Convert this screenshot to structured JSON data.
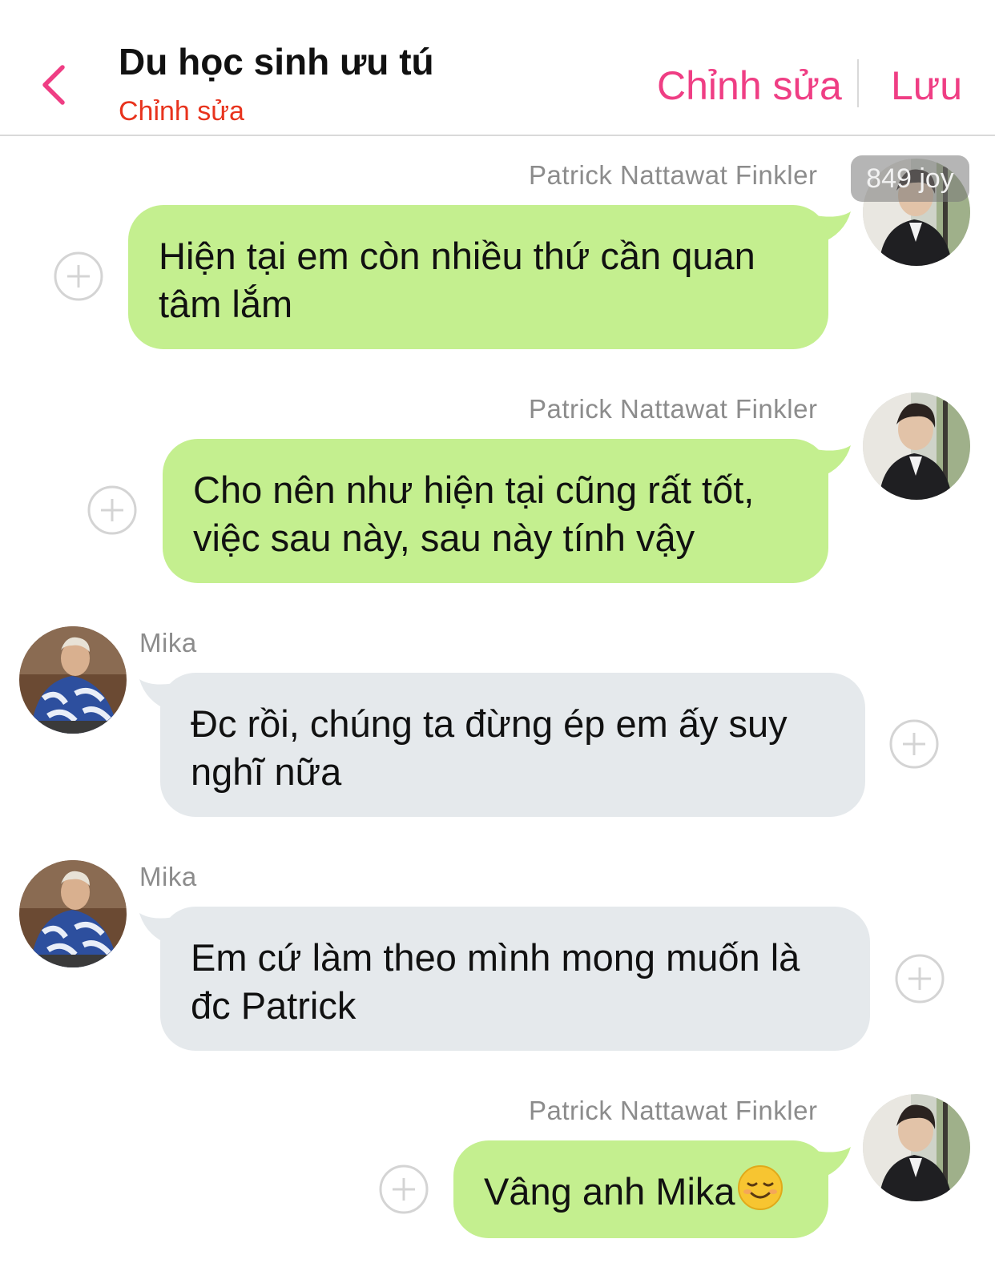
{
  "header": {
    "title": "Du học sinh ưu tú",
    "subtitle": "Chỉnh sửa",
    "edit_label": "Chỉnh sửa",
    "save_label": "Lưu"
  },
  "watermark": "849 joy",
  "messages": [
    {
      "sender": "Patrick Nattawat Finkler",
      "direction": "outgoing",
      "text": "Hiện tại em còn nhiều thứ cần quan tâm lắm"
    },
    {
      "sender": "Patrick Nattawat Finkler",
      "direction": "outgoing",
      "text": "Cho nên như hiện tại cũng rất tốt, việc sau này, sau này tính vậy"
    },
    {
      "sender": "Mika",
      "direction": "incoming",
      "text": "Đc rồi, chúng ta đừng ép em ấy suy nghĩ nữa"
    },
    {
      "sender": "Mika",
      "direction": "incoming",
      "text": "Em cứ làm theo mình mong muốn là đc Patrick"
    },
    {
      "sender": "Patrick Nattawat Finkler",
      "direction": "outgoing",
      "text": "Vâng anh Mika",
      "emoji": "relieved-smile-emoji"
    }
  ],
  "colors": {
    "accent": "#ef3e84",
    "subtitle": "#e8331d",
    "outgoing_bubble": "#c4ef8f",
    "incoming_bubble": "#e5e9ec",
    "sender_text": "#8c8c8c"
  },
  "icons": {
    "back": "chevron-left-icon",
    "add": "plus-circle-icon"
  }
}
